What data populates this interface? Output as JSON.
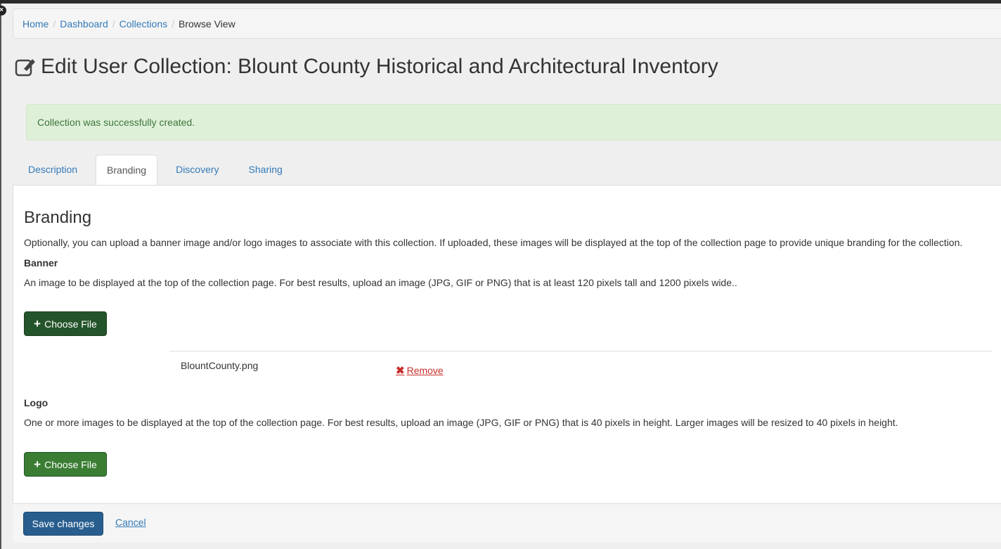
{
  "breadcrumb": {
    "items": [
      "Home",
      "Dashboard",
      "Collections"
    ],
    "current": "Browse View"
  },
  "page_title": "Edit User Collection: Blount County Historical and Architectural Inventory",
  "alert": "Collection was successfully created.",
  "tabs": [
    {
      "label": "Description",
      "active": false
    },
    {
      "label": "Branding",
      "active": true
    },
    {
      "label": "Discovery",
      "active": false
    },
    {
      "label": "Sharing",
      "active": false
    }
  ],
  "branding": {
    "heading": "Branding",
    "intro": "Optionally, you can upload a banner image and/or logo images to associate with this collection. If uploaded, these images will be displayed at the top of the collection page to provide unique branding for the collection.",
    "banner_label": "Banner",
    "banner_help": "An image to be displayed at the top of the collection page. For best results, upload an image (JPG, GIF or PNG) that is at least 120 pixels tall and 1200 pixels wide..",
    "choose_file": "Choose File",
    "banner_file": "BlountCounty.png",
    "remove_label": "Remove",
    "logo_label": "Logo",
    "logo_help": "One or more images to be displayed at the top of the collection page. For best results, upload an image (JPG, GIF or PNG) that is 40 pixels in height. Larger images will be resized to 40 pixels in height."
  },
  "footer": {
    "save_label": "Save changes",
    "cancel_label": "Cancel"
  },
  "colors": {
    "link": "#337ab7",
    "success_bg": "#dff0d8",
    "success_text": "#3c763d",
    "primary": "#285e8e",
    "file_button": "#3a7d33",
    "danger": "#c9302c"
  }
}
